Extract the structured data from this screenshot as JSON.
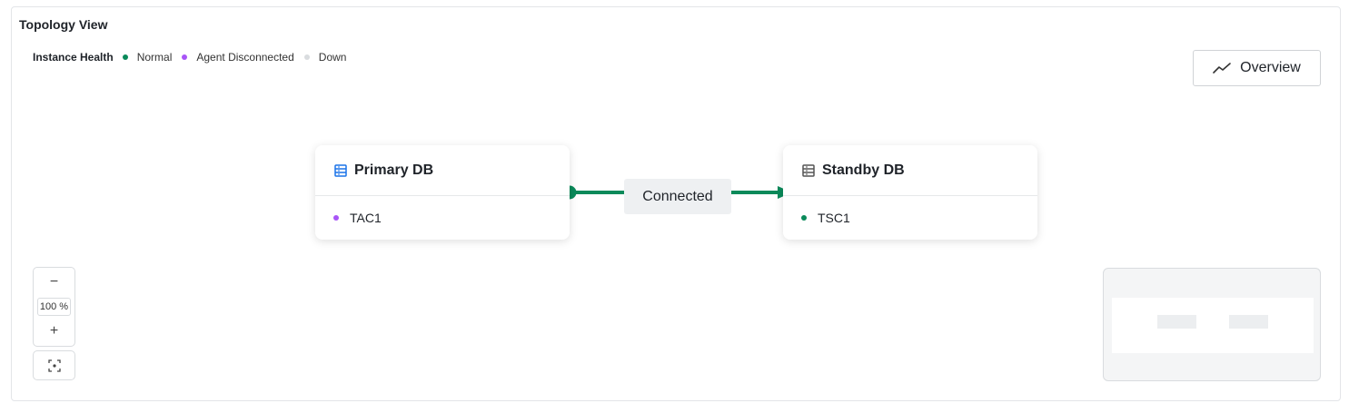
{
  "title": "Topology View",
  "legend": {
    "label": "Instance Health",
    "items": [
      {
        "label": "Normal",
        "color": "#0a8a5a"
      },
      {
        "label": "Agent Disconnected",
        "color": "#a855f7"
      },
      {
        "label": "Down",
        "color": "#d9dcdf"
      }
    ]
  },
  "overview_button": {
    "label": "Overview",
    "icon": "line-chart-icon"
  },
  "nodes": {
    "primary": {
      "title": "Primary DB",
      "icon": "database-icon",
      "icon_color": "#1a73e8",
      "instance": {
        "name": "TAC1",
        "status_color": "#a855f7"
      }
    },
    "standby": {
      "title": "Standby DB",
      "icon": "database-icon",
      "icon_color": "#555555",
      "instance": {
        "name": "TSC1",
        "status_color": "#0a8a5a"
      }
    }
  },
  "edge": {
    "label": "Connected",
    "color": "#0a8a5a"
  },
  "zoom": {
    "minus": "−",
    "level": "100 %",
    "plus": "+",
    "fit_icon": "fit-view-icon"
  },
  "minimap": {
    "icon": "minimap"
  }
}
